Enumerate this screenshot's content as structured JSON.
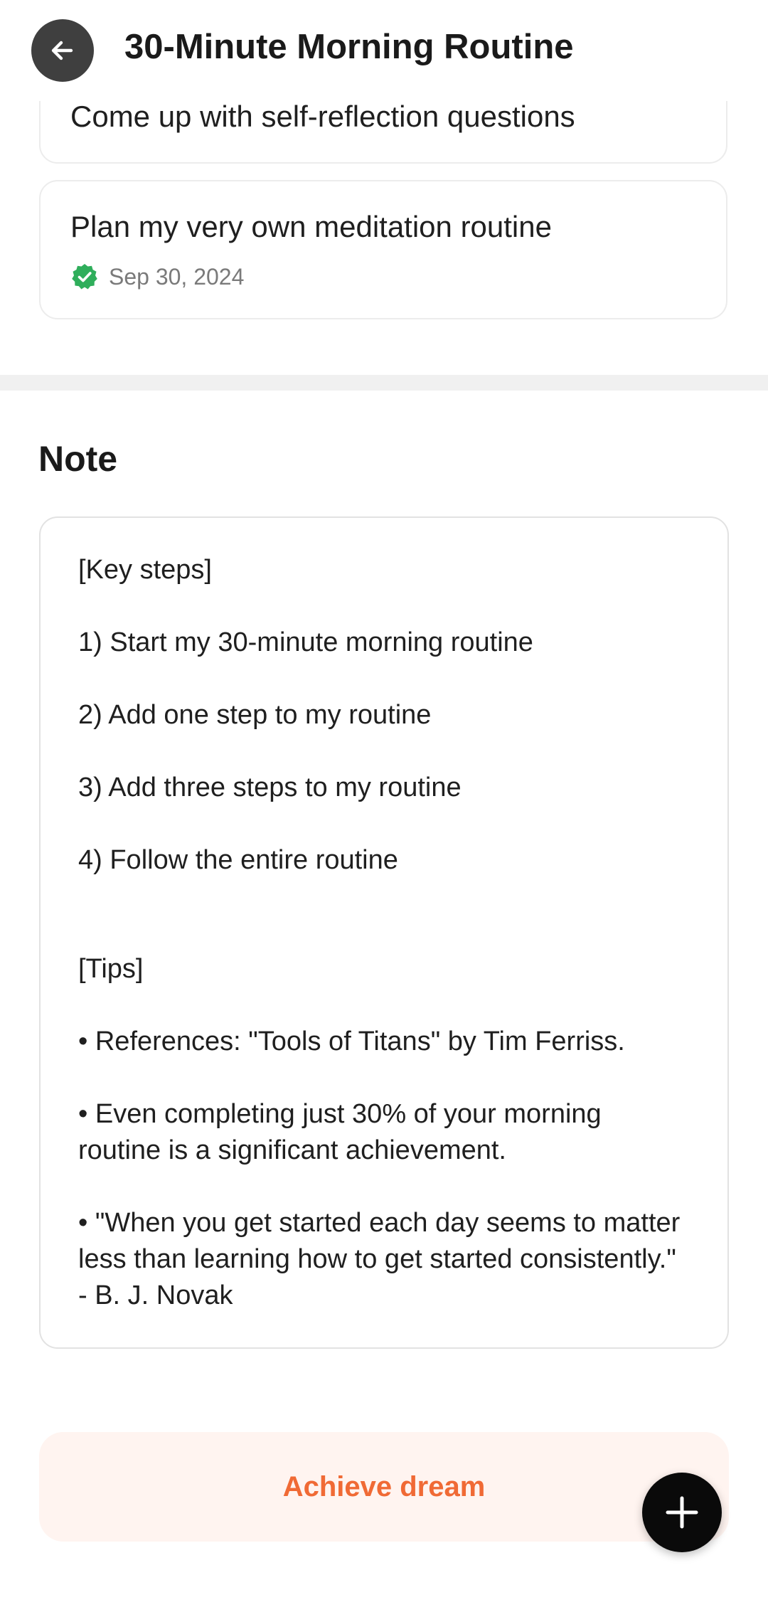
{
  "header": {
    "title": "30-Minute Morning Routine",
    "back_icon": "arrow-left-icon"
  },
  "tasks": [
    {
      "title": "Come up with self-reflection questions"
    },
    {
      "title": "Plan my very own meditation routine",
      "completed_date": "Sep 30, 2024",
      "status_icon": "verified-check-icon"
    }
  ],
  "note": {
    "heading": "Note",
    "lines": [
      "[Key steps]",
      "1) Start my 30-minute morning routine",
      "2) Add one step to my routine",
      "3) Add three steps to my routine",
      "4) Follow the entire routine",
      "[Tips]",
      "• References: \"Tools of Titans\" by Tim Ferriss.",
      "• Even completing just 30% of your morning routine is a significant achievement.",
      "• \"When you get started each day seems to matter less than learning how to get started consistently.\" - B. J. Novak"
    ]
  },
  "actions": {
    "achieve_label": "Achieve dream",
    "fab_icon": "plus-icon"
  },
  "colors": {
    "accent": "#f06a35",
    "accent_bg": "#fff4f0",
    "check_green": "#2fae5b",
    "back_button_bg": "#3f3f3f",
    "fab_bg": "#0a0a0a"
  }
}
